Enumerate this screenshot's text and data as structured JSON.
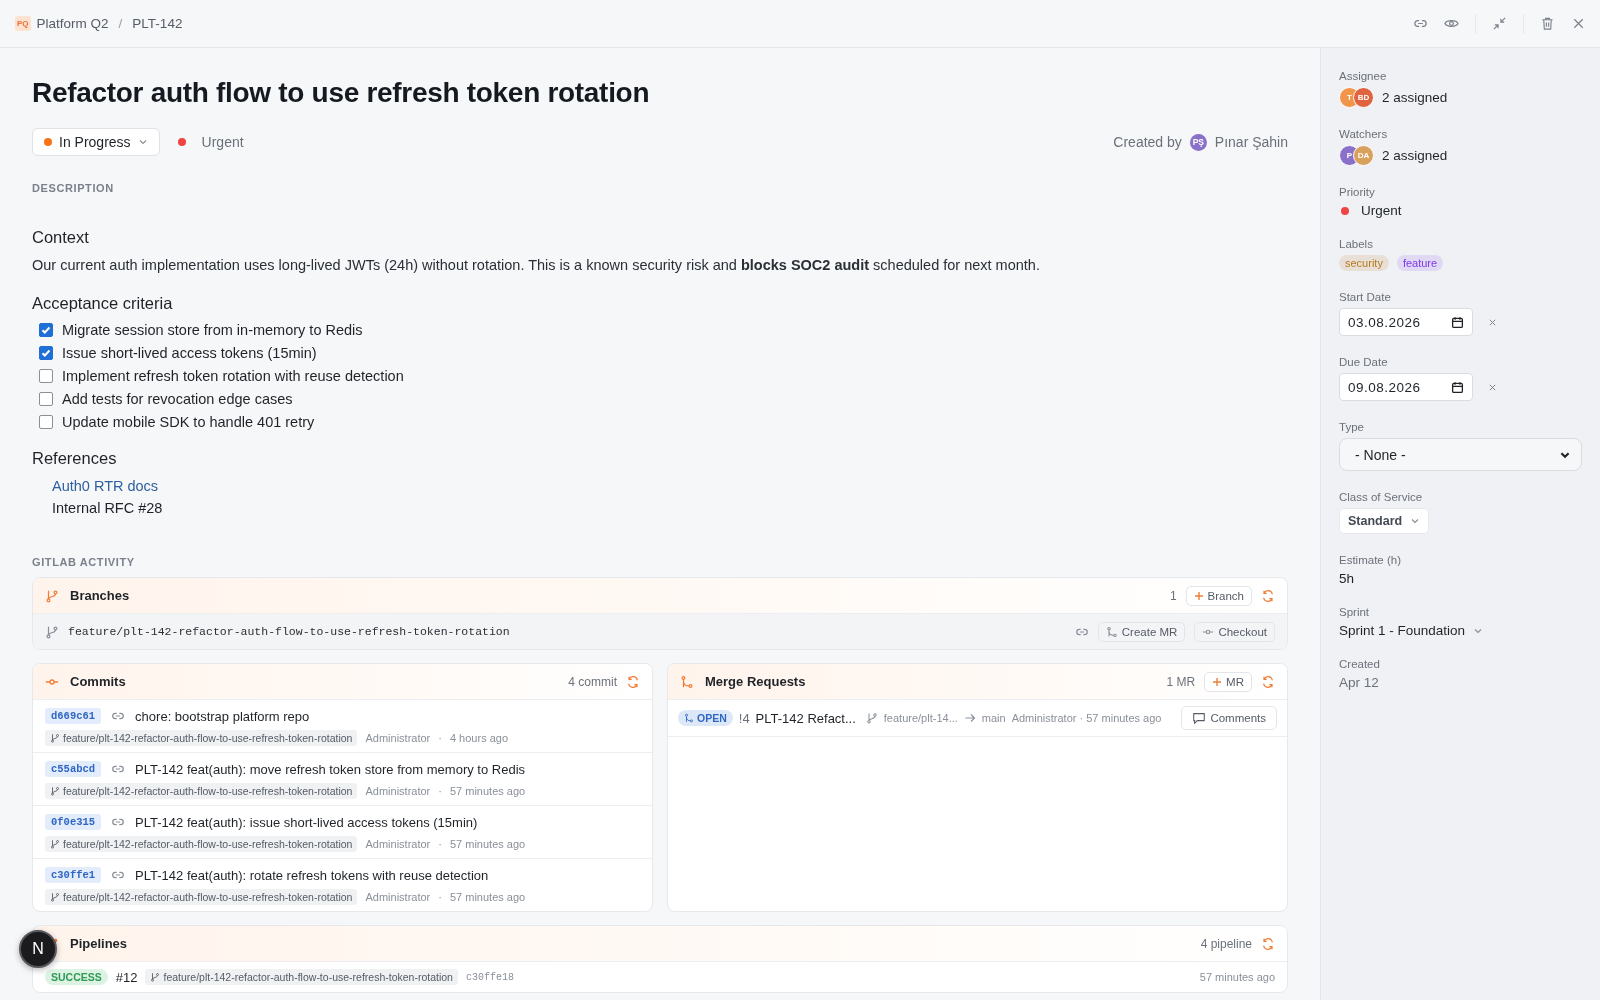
{
  "breadcrumb": {
    "project_badge": "PQ",
    "project": "Platform Q2",
    "separator": "/",
    "issue": "PLT-142"
  },
  "title": "Refactor auth flow to use refresh token rotation",
  "status": {
    "label": "In Progress",
    "color": "#f97316"
  },
  "priority_chip": {
    "label": "Urgent",
    "color": "#ef4444"
  },
  "created_by": {
    "label": "Created by",
    "initials": "PŞ",
    "name": "Pınar Şahin"
  },
  "description": {
    "heading": "DESCRIPTION",
    "context_heading": "Context",
    "context_text": "Our current auth implementation uses long-lived JWTs (24h) without rotation. This is a known security risk and **blocks SOC2 audit** scheduled for next month.",
    "criteria_heading": "Acceptance criteria",
    "criteria": [
      {
        "label": "Migrate session store from in-memory to Redis",
        "checked": true
      },
      {
        "label": "Issue short-lived access tokens (15min)",
        "checked": true
      },
      {
        "label": "Implement refresh token rotation with reuse detection",
        "checked": false
      },
      {
        "label": "Add tests for revocation edge cases",
        "checked": false
      },
      {
        "label": "Update mobile SDK to handle 401 retry",
        "checked": false
      }
    ],
    "references_heading": "References",
    "references": [
      {
        "label": "Auth0 RTR docs",
        "kind": "link"
      },
      {
        "label": "Internal RFC #28",
        "kind": "text"
      }
    ]
  },
  "gitlab": {
    "heading": "GITLAB ACTIVITY",
    "branches": {
      "title": "Branches",
      "count": "1",
      "add_label": "Branch",
      "items": [
        {
          "name": "feature/plt-142-refactor-auth-flow-to-use-refresh-token-rotation",
          "create_mr": "Create MR",
          "checkout": "Checkout"
        }
      ]
    },
    "commits": {
      "title": "Commits",
      "count": "4 commit",
      "separator": "·",
      "items": [
        {
          "sha": "d669c61",
          "message": "chore: bootstrap platform repo",
          "branch": "feature/plt-142-refactor-auth-flow-to-use-refresh-token-rotation",
          "author": "Administrator",
          "time": "4 hours ago"
        },
        {
          "sha": "c55abcd",
          "message": "PLT-142 feat(auth): move refresh token store from memory to Redis",
          "branch": "feature/plt-142-refactor-auth-flow-to-use-refresh-token-rotation",
          "author": "Administrator",
          "time": "57 minutes ago"
        },
        {
          "sha": "0f0e315",
          "message": "PLT-142 feat(auth): issue short-lived access tokens (15min)",
          "branch": "feature/plt-142-refactor-auth-flow-to-use-refresh-token-rotation",
          "author": "Administrator",
          "time": "57 minutes ago"
        },
        {
          "sha": "c30ffe1",
          "message": "PLT-142 feat(auth): rotate refresh tokens with reuse detection",
          "branch": "feature/plt-142-refactor-auth-flow-to-use-refresh-token-rotation",
          "author": "Administrator",
          "time": "57 minutes ago"
        }
      ]
    },
    "merge_requests": {
      "title": "Merge Requests",
      "count": "1 MR",
      "add_label": "MR",
      "items": [
        {
          "state": "OPEN",
          "iid": "!4",
          "title": "PLT-142 Refact...",
          "source": "feature/plt-14...",
          "target": "main",
          "author": "Administrator · 57 minutes ago",
          "comments": "Comments"
        }
      ]
    },
    "pipelines": {
      "title": "Pipelines",
      "count": "4 pipeline",
      "items": [
        {
          "status": "SUCCESS",
          "number": "#12",
          "branch": "feature/plt-142-refactor-auth-flow-to-use-refresh-token-rotation",
          "sha": "c30ffe18",
          "time": "57 minutes ago"
        }
      ]
    }
  },
  "sidebar": {
    "assignee": {
      "label": "Assignee",
      "avatars": [
        {
          "initials": "T",
          "color": "#f0954a"
        },
        {
          "initials": "BD",
          "color": "#e0643f"
        }
      ],
      "text": "2 assigned"
    },
    "watchers": {
      "label": "Watchers",
      "avatars": [
        {
          "initials": "P",
          "color": "#8a70c9"
        },
        {
          "initials": "DA",
          "color": "#d9a15e"
        }
      ],
      "text": "2 assigned"
    },
    "priority": {
      "label": "Priority",
      "value": "Urgent",
      "color": "#ef4444"
    },
    "labels": {
      "label": "Labels",
      "items": [
        {
          "name": "security",
          "color": "#b7791f"
        },
        {
          "name": "feature",
          "color": "#7c3aed"
        }
      ]
    },
    "start_date": {
      "label": "Start Date",
      "value": "03.08.2026"
    },
    "due_date": {
      "label": "Due Date",
      "value": "09.08.2026"
    },
    "type": {
      "label": "Type",
      "value": "- None -"
    },
    "class_of_service": {
      "label": "Class of Service",
      "value": "Standard"
    },
    "estimate": {
      "label": "Estimate (h)",
      "value": "5h"
    },
    "sprint": {
      "label": "Sprint",
      "value": "Sprint 1 - Foundation"
    },
    "created": {
      "label": "Created",
      "value": "Apr 12"
    }
  },
  "dev_badge": "N"
}
